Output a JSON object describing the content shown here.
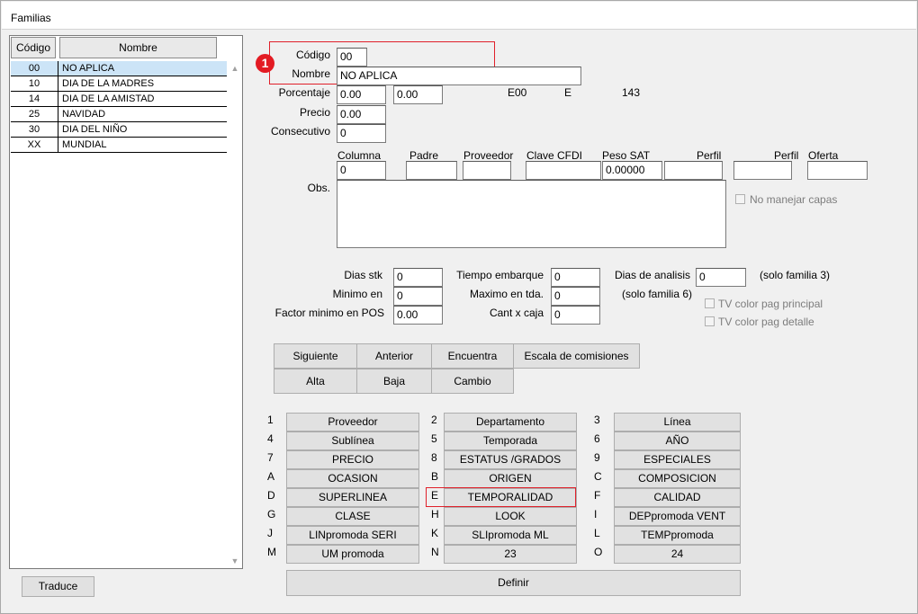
{
  "window": {
    "title": "Familias"
  },
  "list": {
    "col_codigo": "Código",
    "col_nombre": "Nombre",
    "rows": [
      {
        "codigo": "00",
        "nombre": "NO APLICA"
      },
      {
        "codigo": "10",
        "nombre": "DIA DE LA MADRES"
      },
      {
        "codigo": "14",
        "nombre": "DIA DE LA AMISTAD"
      },
      {
        "codigo": "25",
        "nombre": "NAVIDAD"
      },
      {
        "codigo": "30",
        "nombre": "DIA DEL NIÑO"
      },
      {
        "codigo": "XX",
        "nombre": "MUNDIAL"
      }
    ],
    "selected_index": 0
  },
  "traduce_label": "Traduce",
  "annotation": {
    "badge": "1"
  },
  "form": {
    "codigo_label": "Código",
    "codigo_value": "00",
    "nombre_label": "Nombre",
    "nombre_value": "NO APLICA",
    "porcentaje_label": "Porcentaje",
    "porcentaje_value1": "0.00",
    "porcentaje_value2": "0.00",
    "e00_text": "E00",
    "e_text": "E",
    "num_text": "143",
    "precio_label": "Precio",
    "precio_value": "0.00",
    "consecutivo_label": "Consecutivo",
    "consecutivo_value": "0",
    "columna_label": "Columna",
    "columna_value": "0",
    "padre_label": "Padre",
    "padre_value": "",
    "proveedor_label": "Proveedor",
    "proveedor_value": "",
    "clave_cfdi_label": "Clave CFDI",
    "clave_cfdi_value": "",
    "peso_sat_label": "Peso SAT",
    "peso_sat_value": "0.00000",
    "perfil1_label": "Perfil",
    "perfil1_value": "",
    "perfil2_label": "Perfil",
    "perfil2_value": "",
    "oferta_label": "Oferta",
    "oferta_value": "",
    "obs_label": "Obs.",
    "obs_value": "",
    "no_manejar_capas_label": "No manejar capas",
    "dias_stk_label": "Dias stk",
    "dias_stk_value": "0",
    "minimo_en_label": "Minimo en",
    "minimo_en_value": "0",
    "factor_minimo_label": "Factor minimo en POS",
    "factor_minimo_value": "0.00",
    "tiempo_embarque_label": "Tiempo embarque",
    "tiempo_embarque_value": "0",
    "maximo_tda_label": "Maximo en tda.",
    "maximo_tda_value": "0",
    "cant_caja_label": "Cant x caja",
    "cant_caja_value": "0",
    "dias_analisis_label": "Dias de analisis",
    "dias_analisis_value": "0",
    "solo_familia3": "(solo familia 3)",
    "solo_familia6": "(solo familia 6)",
    "tv_principal_label": "TV color pag principal",
    "tv_detalle_label": "TV color pag detalle"
  },
  "nav_buttons": {
    "siguiente": "Siguiente",
    "anterior": "Anterior",
    "encuentra": "Encuentra",
    "escala": "Escala de comisiones",
    "alta": "Alta",
    "baja": "Baja",
    "cambio": "Cambio"
  },
  "grid": [
    {
      "key": "1",
      "label": "Proveedor"
    },
    {
      "key": "2",
      "label": "Departamento"
    },
    {
      "key": "3",
      "label": "Línea"
    },
    {
      "key": "4",
      "label": "Sublínea"
    },
    {
      "key": "5",
      "label": "Temporada"
    },
    {
      "key": "6",
      "label": "AÑO"
    },
    {
      "key": "7",
      "label": "PRECIO"
    },
    {
      "key": "8",
      "label": "ESTATUS /GRADOS"
    },
    {
      "key": "9",
      "label": "ESPECIALES"
    },
    {
      "key": "A",
      "label": "OCASION"
    },
    {
      "key": "B",
      "label": "ORIGEN"
    },
    {
      "key": "C",
      "label": "COMPOSICION"
    },
    {
      "key": "D",
      "label": "SUPERLINEA"
    },
    {
      "key": "E",
      "label": "TEMPORALIDAD"
    },
    {
      "key": "F",
      "label": "CALIDAD"
    },
    {
      "key": "G",
      "label": "CLASE"
    },
    {
      "key": "H",
      "label": "LOOK"
    },
    {
      "key": "I",
      "label": "DEPpromoda VENT"
    },
    {
      "key": "J",
      "label": "LINpromoda SERI"
    },
    {
      "key": "K",
      "label": "SLIpromoda ML"
    },
    {
      "key": "L",
      "label": "TEMPpromoda"
    },
    {
      "key": "M",
      "label": "UM promoda"
    },
    {
      "key": "N",
      "label": "23"
    },
    {
      "key": "O",
      "label": "24"
    }
  ],
  "definir_label": "Definir"
}
